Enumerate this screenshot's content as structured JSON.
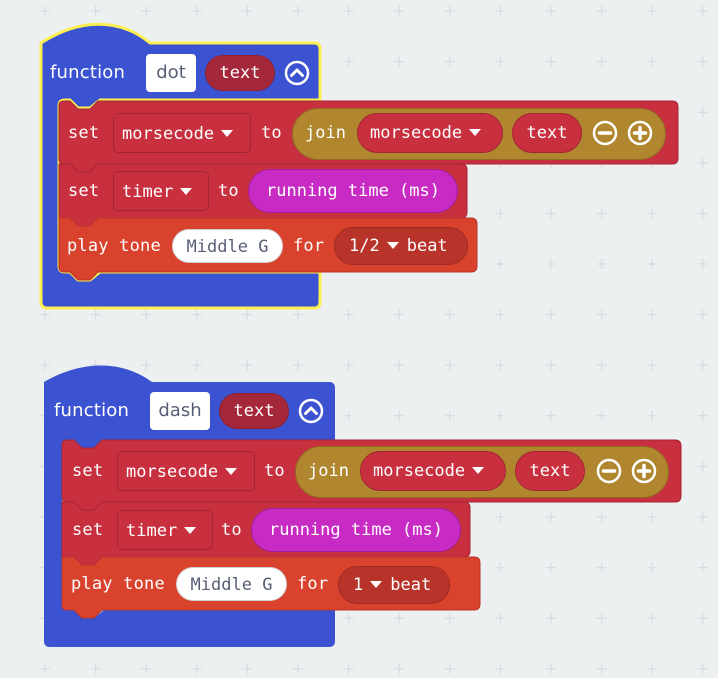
{
  "workspace": {
    "colors": {
      "background": "#ecf0f1",
      "function_block": "#3b53d1",
      "selected_outline": "#fdee52",
      "variables_block": "#c9303f",
      "music_block": "#d9432e",
      "text_join": "#b0872f",
      "running_time": "#c72bc4",
      "param_reporter": "#a4273a"
    }
  },
  "functions": [
    {
      "selected": true,
      "keyword": "function",
      "name": "dot",
      "param": "text",
      "collapse_icon": "chevron-up-circle-icon",
      "statements": {
        "set_morsecode": {
          "set_label": "set",
          "variable": "morsecode",
          "to_label": "to",
          "join_label": "join",
          "join_var": "morsecode",
          "join_text": "text",
          "remove_icon": "minus-circle-icon",
          "add_icon": "plus-circle-icon"
        },
        "set_timer": {
          "set_label": "set",
          "variable": "timer",
          "to_label": "to",
          "value": "running time (ms)"
        },
        "play_tone": {
          "label": "play tone",
          "note": "Middle G",
          "for_label": "for",
          "duration": "1/2",
          "beat_label": "beat"
        }
      }
    },
    {
      "selected": false,
      "keyword": "function",
      "name": "dash",
      "param": "text",
      "collapse_icon": "chevron-up-circle-icon",
      "statements": {
        "set_morsecode": {
          "set_label": "set",
          "variable": "morsecode",
          "to_label": "to",
          "join_label": "join",
          "join_var": "morsecode",
          "join_text": "text",
          "remove_icon": "minus-circle-icon",
          "add_icon": "plus-circle-icon"
        },
        "set_timer": {
          "set_label": "set",
          "variable": "timer",
          "to_label": "to",
          "value": "running time (ms)"
        },
        "play_tone": {
          "label": "play tone",
          "note": "Middle G",
          "for_label": "for",
          "duration": "1",
          "beat_label": "beat"
        }
      }
    }
  ]
}
